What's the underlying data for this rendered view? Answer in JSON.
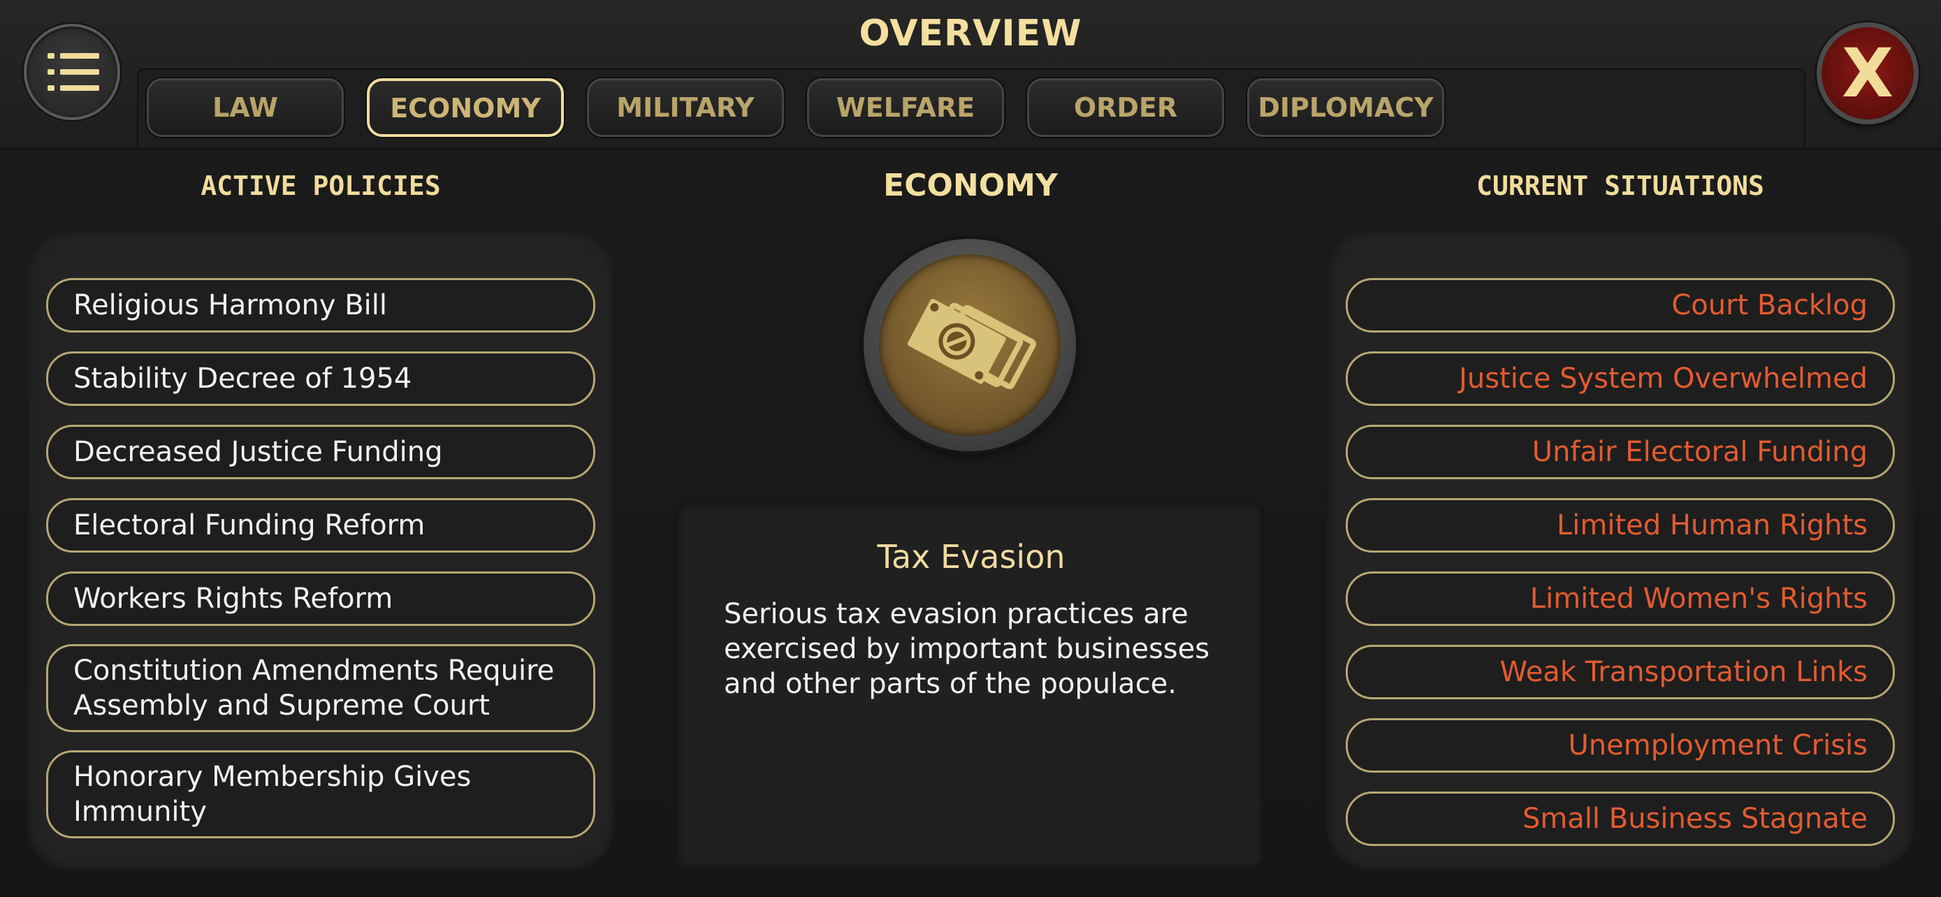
{
  "header": {
    "title": "OVERVIEW",
    "menu_icon": "list-icon",
    "close_label": "X"
  },
  "tabs": [
    {
      "label": "LAW",
      "active": false
    },
    {
      "label": "ECONOMY",
      "active": true
    },
    {
      "label": "MILITARY",
      "active": false
    },
    {
      "label": "WELFARE",
      "active": false
    },
    {
      "label": "ORDER",
      "active": false
    },
    {
      "label": "DIPLOMACY",
      "active": false
    }
  ],
  "active_policies": {
    "heading": "ACTIVE POLICIES",
    "items": [
      "Religious Harmony Bill",
      "Stability Decree of 1954",
      "Decreased Justice Funding",
      "Electoral Funding Reform",
      "Workers Rights Reform",
      "Constitution Amendments Require Assembly and Supreme Court",
      "Honorary Membership Gives Immunity"
    ]
  },
  "center": {
    "heading": "ECONOMY",
    "emblem_icon": "money-bills-icon",
    "detail_title": "Tax Evasion",
    "detail_text": "Serious tax evasion practices are exercised by important businesses and other parts of the populace."
  },
  "current_situations": {
    "heading": "CURRENT SITUATIONS",
    "items": [
      "Court Backlog",
      "Justice System Overwhelmed",
      "Unfair Electoral Funding",
      "Limited Human Rights",
      "Limited Women's Rights",
      "Weak Transportation Links",
      "Unemployment Crisis",
      "Small Business Stagnate"
    ]
  },
  "colors": {
    "accent_gold": "#f1dc9c",
    "tab_text": "#b9a46a",
    "situation_red": "#e35b30",
    "close_red": "#8c1a16"
  }
}
